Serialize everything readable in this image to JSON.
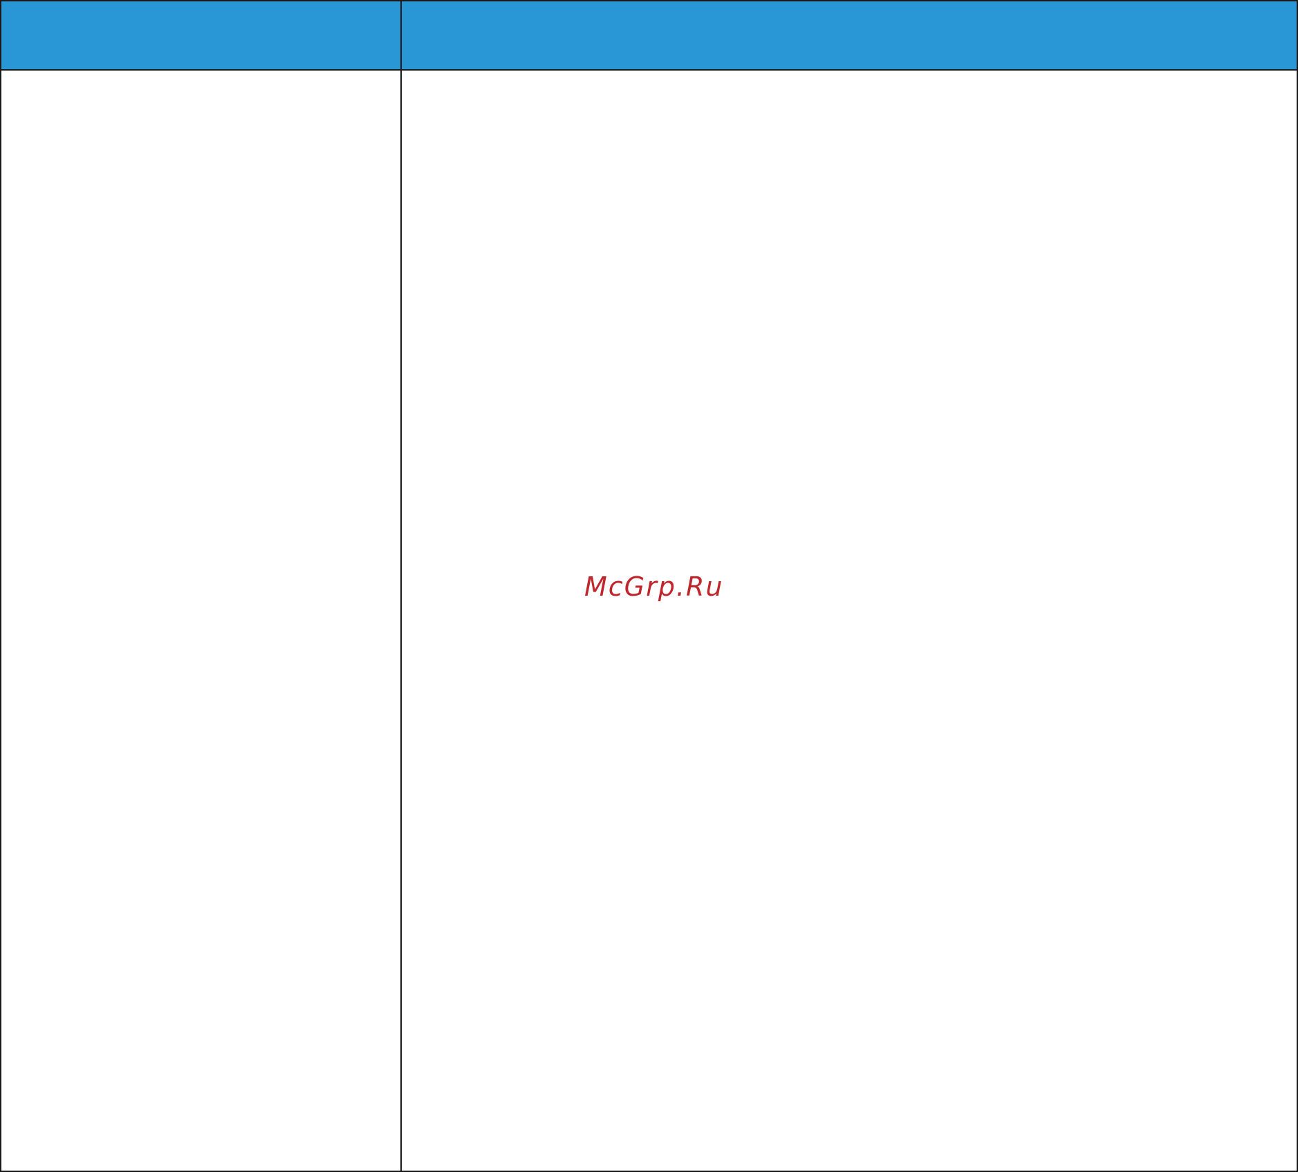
{
  "table": {
    "header": {
      "left": "",
      "right": ""
    },
    "body": {
      "left": "",
      "right": ""
    }
  },
  "watermark": {
    "text": "McGrp.Ru"
  },
  "colors": {
    "header_background": "#2997d5",
    "border": "#1a1a1a",
    "watermark": "#c0272d"
  }
}
